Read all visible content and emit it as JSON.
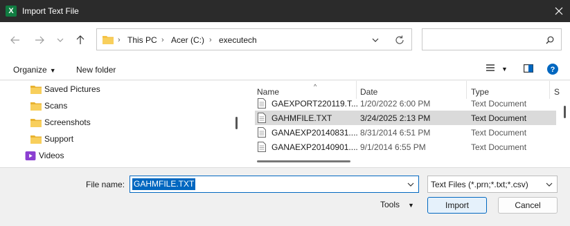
{
  "window": {
    "title": "Import Text File",
    "app_icon_letter": "X"
  },
  "address_bar": {
    "crumbs": [
      "This PC",
      "Acer (C:)",
      "executech"
    ]
  },
  "search": {
    "placeholder": ""
  },
  "toolbar": {
    "organize": "Organize",
    "new_folder": "New folder"
  },
  "tree": [
    {
      "label": "Saved Pictures",
      "icon": "folder-icon"
    },
    {
      "label": "Scans",
      "icon": "folder-icon"
    },
    {
      "label": "Screenshots",
      "icon": "folder-icon"
    },
    {
      "label": "Support",
      "icon": "folder-icon"
    },
    {
      "label": "Videos",
      "icon": "videos-icon"
    }
  ],
  "columns": {
    "name": "Name",
    "date": "Date",
    "type": "Type",
    "size": "S"
  },
  "files": [
    {
      "name": "GAEXPORT220119.T...",
      "date": "1/20/2022 6:00 PM",
      "type": "Text Document",
      "selected": false
    },
    {
      "name": "GAHMFILE.TXT",
      "date": "3/24/2025 2:13 PM",
      "type": "Text Document",
      "selected": true
    },
    {
      "name": "GANAEXP20140831....",
      "date": "8/31/2014 6:51 PM",
      "type": "Text Document",
      "selected": false
    },
    {
      "name": "GANAEXP20140901....",
      "date": "9/1/2014 6:55 PM",
      "type": "Text Document",
      "selected": false
    }
  ],
  "footer": {
    "file_name_label": "File name:",
    "file_name_value": "GAHMFILE.TXT",
    "file_type": "Text Files (*.prn;*.txt;*.csv)",
    "tools": "Tools",
    "import": "Import",
    "cancel": "Cancel"
  },
  "colors": {
    "accent": "#0067c0",
    "titlebar": "#2b2b2b",
    "folder": "#f5c244",
    "selection": "#dadada"
  }
}
